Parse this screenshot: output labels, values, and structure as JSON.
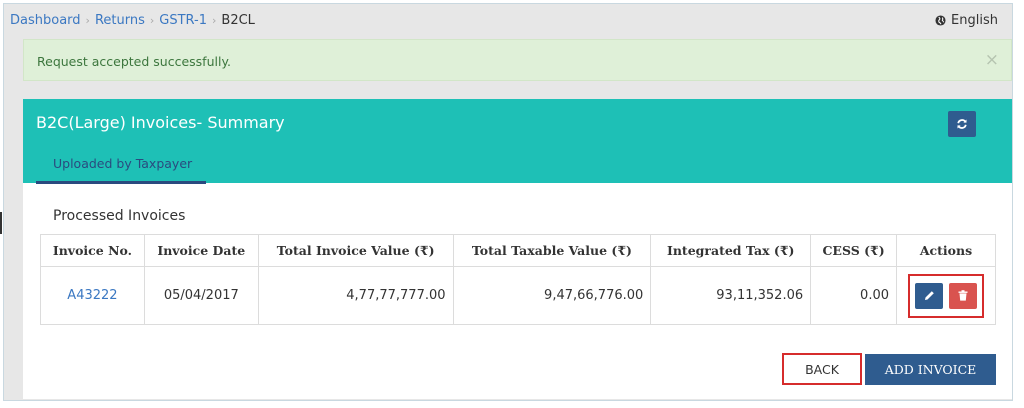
{
  "breadcrumb": {
    "items": [
      "Dashboard",
      "Returns",
      "GSTR-1"
    ],
    "current": "B2CL",
    "separator": "›"
  },
  "language": {
    "label": "English",
    "icon": "globe-icon"
  },
  "alert": {
    "message": "Request accepted successfully.",
    "close_symbol": "×"
  },
  "card": {
    "title": "B2C(Large) Invoices- Summary",
    "tab_label": "Uploaded by Taxpayer",
    "refresh_icon": "refresh-icon"
  },
  "section": {
    "title": "Processed Invoices"
  },
  "table": {
    "headers": [
      "Invoice No.",
      "Invoice Date",
      "Total Invoice Value (₹)",
      "Total Taxable Value (₹)",
      "Integrated Tax (₹)",
      "CESS (₹)",
      "Actions"
    ],
    "rows": [
      {
        "invoice_no": "A43222",
        "invoice_date": "05/04/2017",
        "total_invoice_value": "4,77,77,777.00",
        "total_taxable_value": "9,47,66,776.00",
        "integrated_tax": "93,11,352.06",
        "cess": "0.00"
      }
    ]
  },
  "buttons": {
    "back": "BACK",
    "add_invoice": "ADD INVOICE"
  },
  "colors": {
    "header_teal": "#1ec0b6",
    "primary_blue": "#2f5c8f",
    "danger_red": "#d9534f",
    "highlight_red": "#d62c2c",
    "link_blue": "#3b78c2",
    "success_bg": "#dff0d8"
  }
}
